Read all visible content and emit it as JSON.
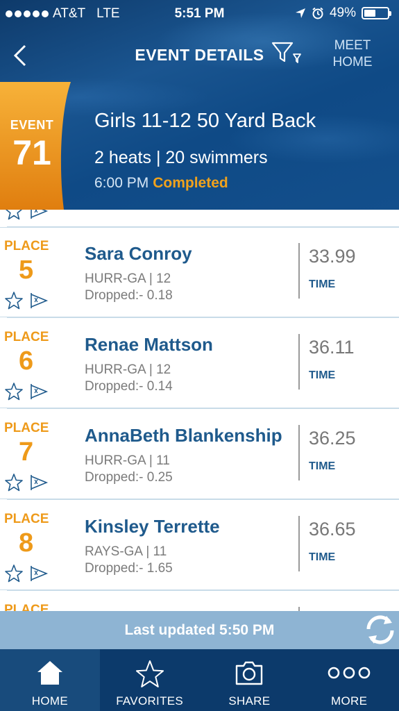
{
  "status_bar": {
    "carrier": "AT&T",
    "network": "LTE",
    "time": "5:51 PM",
    "battery": "49%",
    "battery_level": 0.49
  },
  "nav": {
    "title": "EVENT DETAILS",
    "meet_home_line1": "MEET",
    "meet_home_line2": "HOME"
  },
  "event": {
    "label": "EVENT",
    "number": "71",
    "name": "Girls 11-12 50 Yard Back",
    "counts": "2 heats | 20 swimmers",
    "time": "6:00 PM",
    "status": "Completed"
  },
  "results": [
    {
      "place_label": "PLACE",
      "place": "5",
      "name": "Sara Conroy",
      "team_age": "HURR-GA | 12",
      "dropped": "Dropped:- 0.18",
      "time": "33.99",
      "time_label": "TIME"
    },
    {
      "place_label": "PLACE",
      "place": "6",
      "name": "Renae Mattson",
      "team_age": "HURR-GA | 12",
      "dropped": "Dropped:- 0.14",
      "time": "36.11",
      "time_label": "TIME"
    },
    {
      "place_label": "PLACE",
      "place": "7",
      "name": "AnnaBeth Blankenship",
      "team_age": "HURR-GA | 11",
      "dropped": "Dropped:- 0.25",
      "time": "36.25",
      "time_label": "TIME"
    },
    {
      "place_label": "PLACE",
      "place": "8",
      "name": "Kinsley Terrette",
      "team_age": "RAYS-GA | 11",
      "dropped": "Dropped:- 1.65",
      "time": "36.65",
      "time_label": "TIME"
    }
  ],
  "partial_next": {
    "place_label": "PLACE"
  },
  "updated": {
    "text": "Last updated 5:50 PM"
  },
  "tabs": [
    {
      "label": "HOME",
      "icon": "home-icon"
    },
    {
      "label": "FAVORITES",
      "icon": "star-icon"
    },
    {
      "label": "SHARE",
      "icon": "camera-icon"
    },
    {
      "label": "MORE",
      "icon": "more-icon"
    }
  ],
  "colors": {
    "accent_orange": "#ee9a1a",
    "name_blue": "#1f5a8c",
    "tabbar": "#0c3a6b",
    "updated_bar": "#8eb4d3"
  }
}
